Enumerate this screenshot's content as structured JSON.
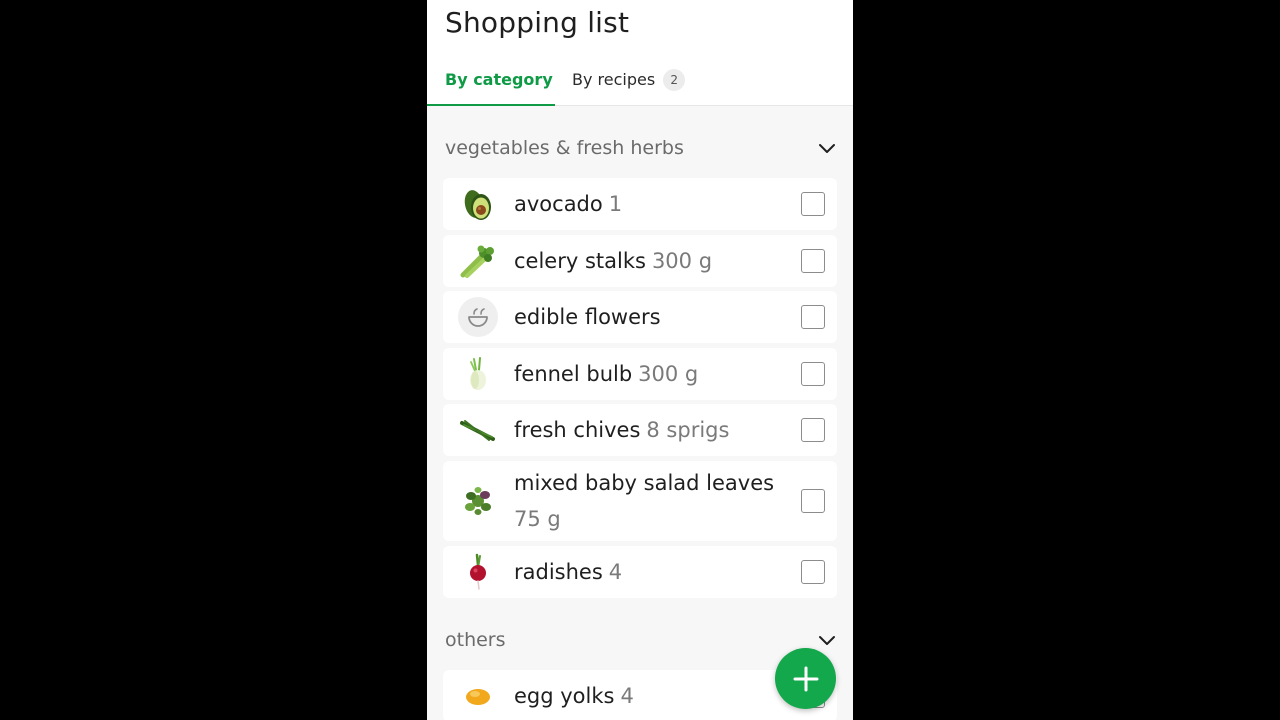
{
  "header": {
    "title": "Shopping list",
    "tabs": [
      {
        "label": "By category",
        "active": true
      },
      {
        "label": "By recipes",
        "badge": "2",
        "active": false
      }
    ]
  },
  "sections": [
    {
      "title": "vegetables & fresh herbs",
      "items": [
        {
          "name": "avocado",
          "qty": "1",
          "icon": "avocado-icon"
        },
        {
          "name": "celery stalks",
          "qty": "300 g",
          "icon": "celery-icon"
        },
        {
          "name": "edible flowers",
          "qty": "",
          "icon": "bowl-placeholder-icon"
        },
        {
          "name": "fennel bulb",
          "qty": "300 g",
          "icon": "fennel-icon"
        },
        {
          "name": "fresh chives",
          "qty": "8 sprigs",
          "icon": "chives-icon"
        },
        {
          "name": "mixed baby salad leaves",
          "qty": "75 g",
          "icon": "salad-leaves-icon"
        },
        {
          "name": "radishes",
          "qty": "4",
          "icon": "radish-icon"
        }
      ]
    },
    {
      "title": "others",
      "items": [
        {
          "name": "egg yolks",
          "qty": "4",
          "icon": "egg-yolk-icon"
        }
      ]
    }
  ],
  "colors": {
    "accent": "#0f9a46",
    "fab": "#12a84b"
  }
}
